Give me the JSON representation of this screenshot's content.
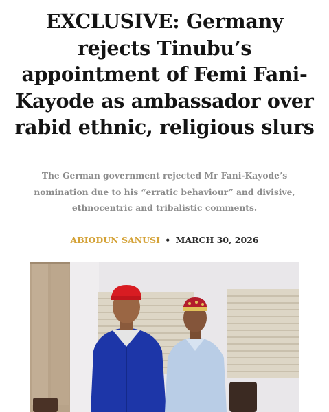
{
  "article": {
    "headline": "EXCLUSIVE: Germany rejects Tinubu’s appointment of Femi Fani-Kayode as ambassador over rabid ethnic, religious slurs",
    "dek": "The German government rejected Mr Fani-Kayode’s nomination due to his “erratic behaviour” and divisive, ethnocentric and tribalistic comments.",
    "author": "ABIODUN SANUSI",
    "separator": "•",
    "date": "MARCH 30, 2026"
  },
  "colors": {
    "author_accent": "#d4a237",
    "headline": "#141414",
    "dek": "#8c8c8c"
  }
}
